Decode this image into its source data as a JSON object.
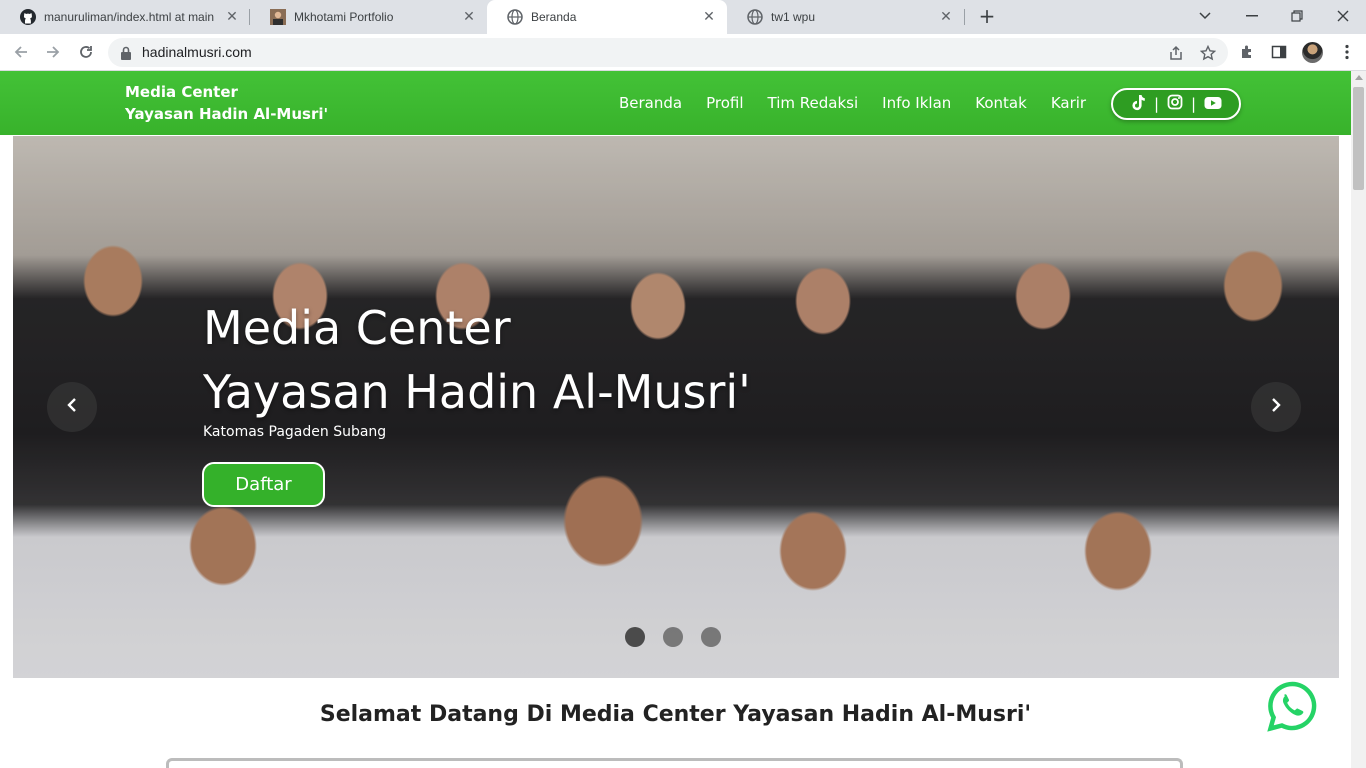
{
  "browser": {
    "tabs": [
      {
        "title": "manuruliman/index.html at main",
        "icon": "github-icon",
        "active": false
      },
      {
        "title": "Mkhotami Portfolio",
        "icon": "portrait-icon",
        "active": false
      },
      {
        "title": "Beranda",
        "icon": "globe-icon",
        "active": true
      },
      {
        "title": "tw1 wpu",
        "icon": "globe-icon",
        "active": false
      }
    ],
    "url": "hadinalmusri.com"
  },
  "site": {
    "brand_line1": "Media Center",
    "brand_line2": "Yayasan Hadin Al-Musri'",
    "menu": [
      "Beranda",
      "Profil",
      "Tim Redaksi",
      "Info Iklan",
      "Kontak",
      "Karir"
    ],
    "social": [
      "tiktok-icon",
      "instagram-icon",
      "youtube-icon"
    ],
    "social_separator": "|"
  },
  "hero": {
    "title_line1": "Media Center",
    "title_line2": "Yayasan Hadin Al-Musri'",
    "subtitle": "Katomas Pagaden Subang",
    "button": "Daftar",
    "slide_count": 3,
    "active_slide": 1
  },
  "welcome": "Selamat Datang Di Media Center Yayasan Hadin Al-Musri'",
  "colors": {
    "nav_green": "#3cba2e",
    "button_green": "#34b12a",
    "whatsapp_green": "#25d366"
  }
}
